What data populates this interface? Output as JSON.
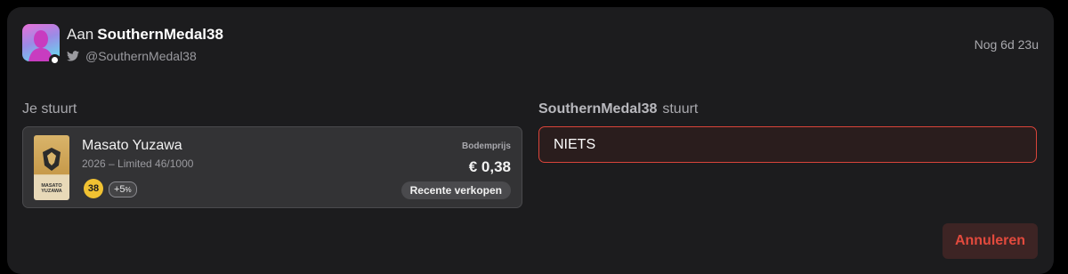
{
  "header": {
    "to_prefix": "Aan",
    "recipient": "SouthernMedal38",
    "handle": "@SouthernMedal38",
    "timer": "Nog 6d 23u"
  },
  "you_send": {
    "label": "Je stuurt",
    "card": {
      "player_name": "Masato Yuzawa",
      "meta": "2026 – Limited 46/1000",
      "thumb_name": "MASATO YUZAWA",
      "rating": "38",
      "boost": "+5",
      "boost_unit": "%",
      "floor_label": "Bodemprijs",
      "floor_price": "€ 0,38",
      "recent_sales": "Recente verkopen"
    }
  },
  "they_send": {
    "name": "SouthernMedal38",
    "label": "stuurt",
    "value": "NIETS"
  },
  "actions": {
    "cancel": "Annuleren"
  },
  "colors": {
    "accent_red": "#e24a3d",
    "rating_gold": "#f1c232"
  }
}
